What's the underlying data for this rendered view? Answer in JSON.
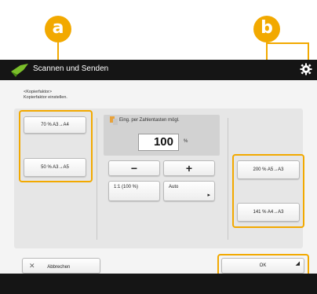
{
  "markers": {
    "a": "a",
    "b": "b"
  },
  "header": {
    "title": "Scannen und Senden"
  },
  "instruction": {
    "line1": "<Kopierfaktor>",
    "line2": "Kopierfaktor einstellen."
  },
  "left_presets": [
    "70 % A3→A4",
    "50 % A3→A5"
  ],
  "right_presets": [
    "200 % A5→A3",
    "141 % A4→A3"
  ],
  "entry": {
    "label": "Eing. per Zahlentasten mögl.",
    "value": "100",
    "unit": "%"
  },
  "stepper": {
    "minus": "−",
    "plus": "+"
  },
  "middle_buttons": {
    "one_to_one": "1:1 (100 %)",
    "auto": "Auto"
  },
  "footer": {
    "cancel": "Abbrechen",
    "ok": "OK"
  },
  "colors": {
    "callout": "#f2a900",
    "titlebar": "#151515"
  }
}
